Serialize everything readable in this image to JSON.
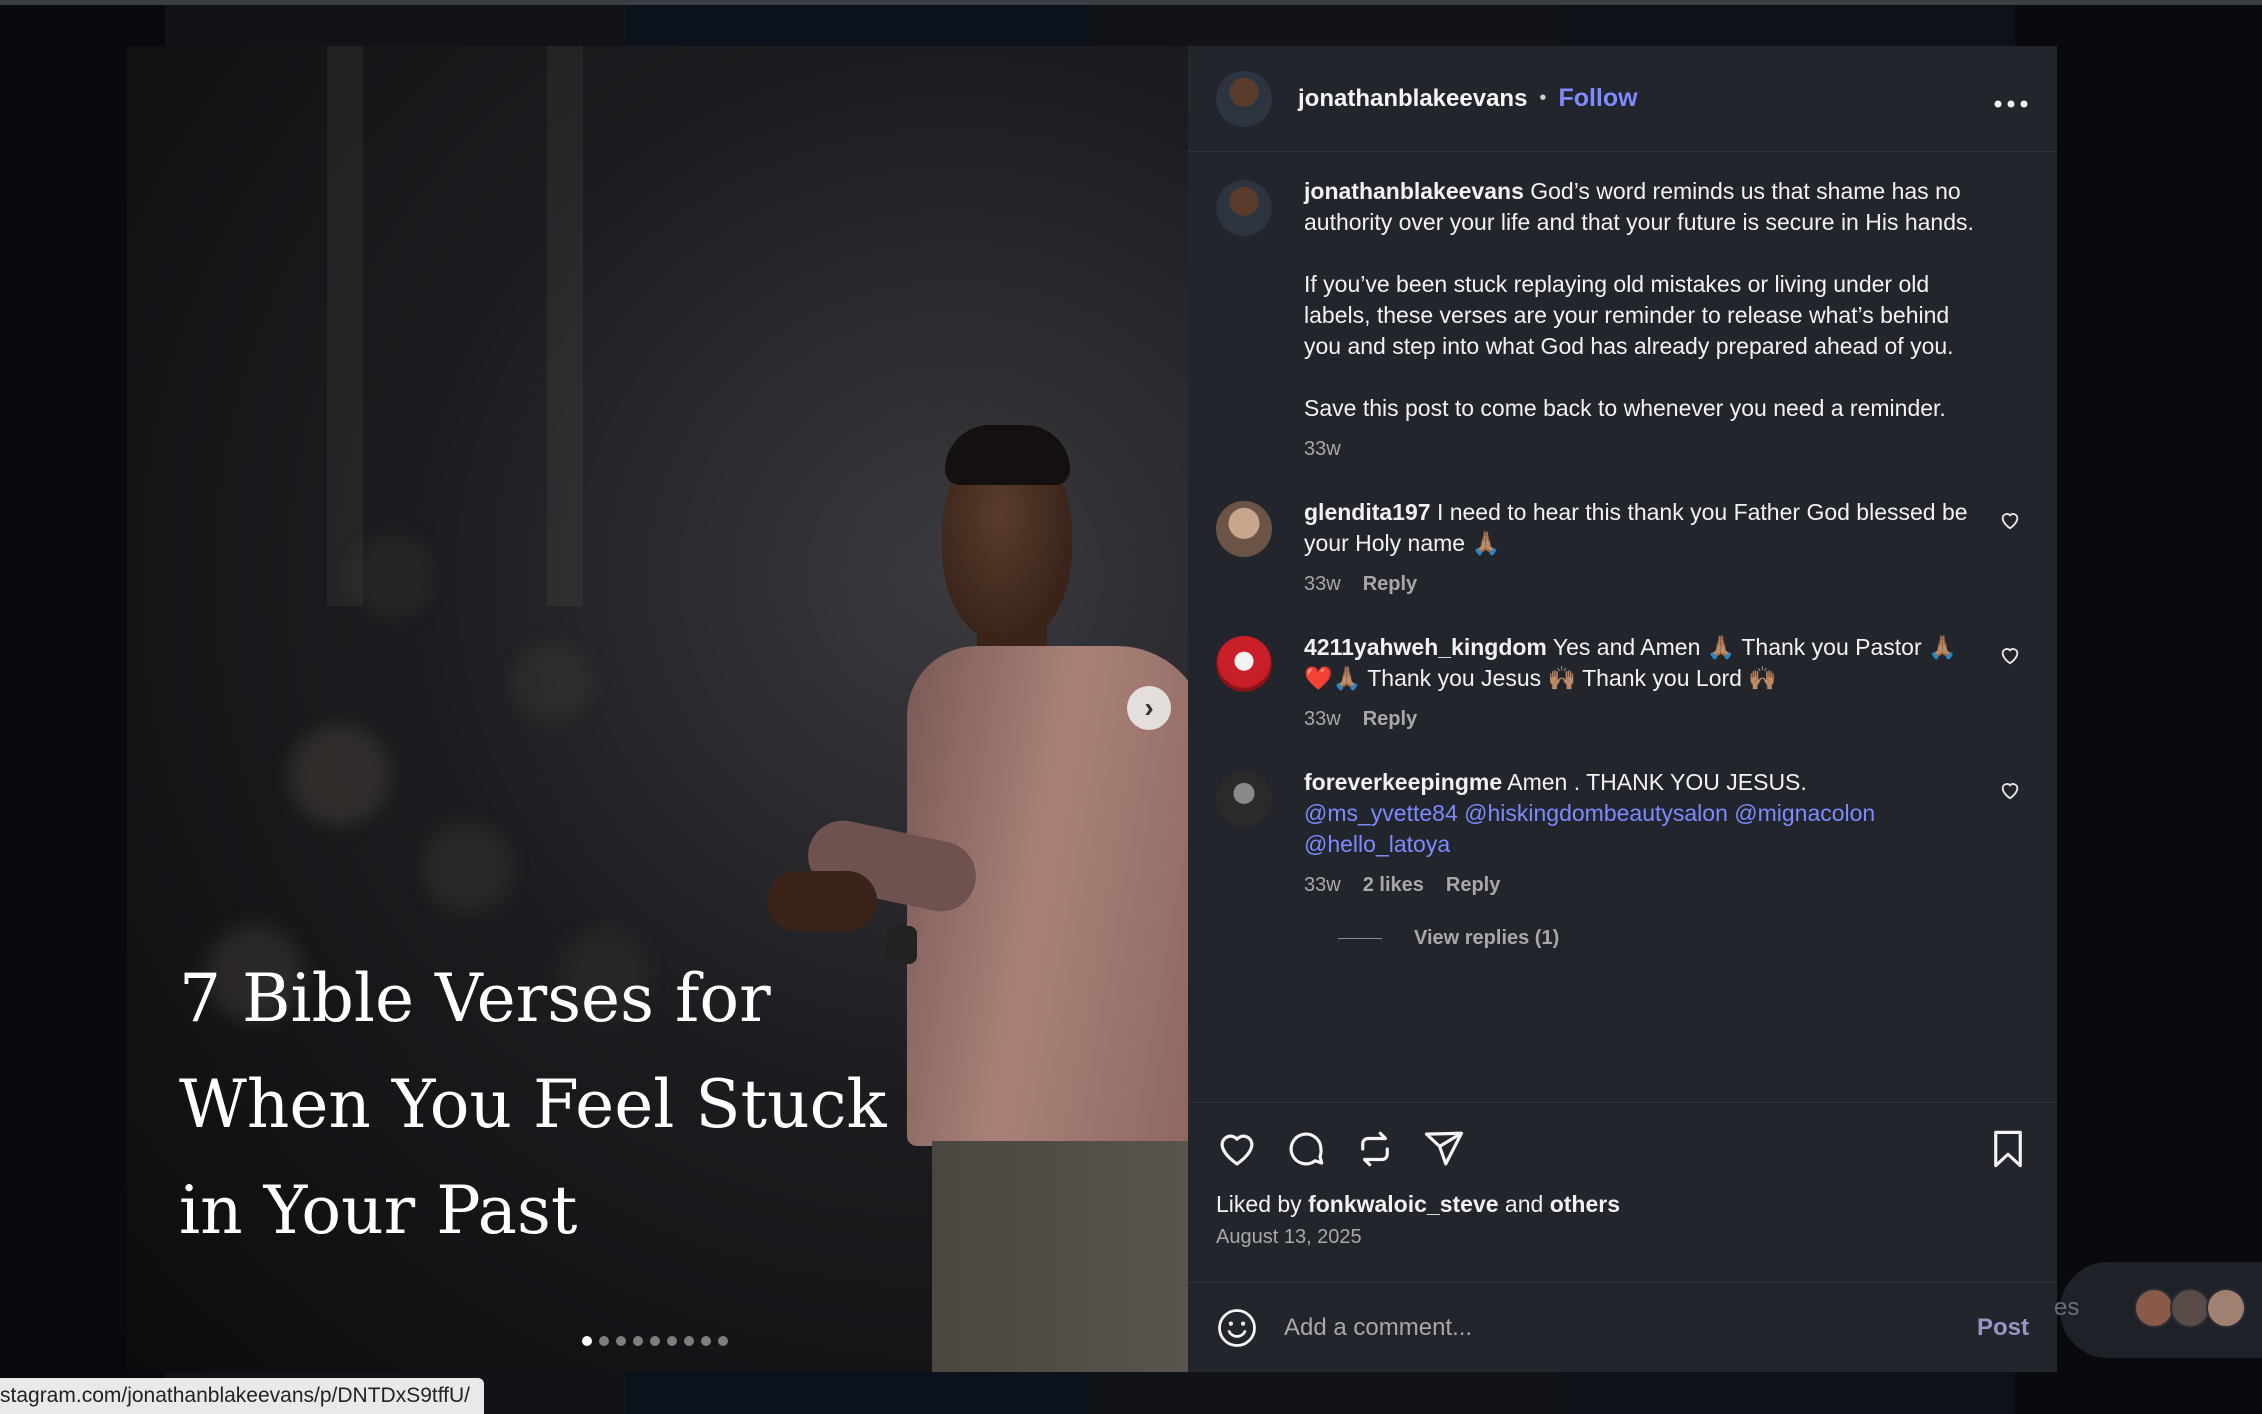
{
  "post": {
    "author": "jonathanblakeevans",
    "follow_label": "Follow",
    "separator": "•",
    "more_label": "•••",
    "media_title": "7 Bible Verses for When You Feel Stuck in Your Past",
    "next_label": "›",
    "slide_count": 9,
    "active_slide": 1
  },
  "caption": {
    "user": "jonathanblakeevans",
    "para1": "God’s word reminds us that shame has no authority over your life and that your future is secure in His hands.",
    "para2": "If you’ve been stuck replaying old mistakes or living under old labels, these verses are your reminder to release what’s behind you and step into what God has already prepared ahead of you.",
    "para3": "Save this post to come back to whenever you need a reminder.",
    "time": "33w"
  },
  "comments": [
    {
      "user": "glendita197",
      "text": "I need to hear this thank you Father God blessed be your Holy name 🙏🏽",
      "time": "33w",
      "reply": "Reply"
    },
    {
      "user": "4211yahweh_kingdom",
      "text": "Yes and Amen 🙏🏽 Thank you Pastor 🙏🏽❤️🙏🏽 Thank you Jesus 🙌🏽 Thank you Lord 🙌🏽",
      "time": "33w",
      "reply": "Reply"
    },
    {
      "user": "foreverkeepingme",
      "text": "Amen . THANK YOU JESUS.",
      "mentions": "@ms_yvette84 @hiskingdombeautysalon @mignacolon @hello_latoya",
      "time": "33w",
      "likes": "2 likes",
      "reply": "Reply",
      "view_replies": "View replies (1)"
    }
  ],
  "actions": {
    "liked_prefix": "Liked by",
    "liked_user": "fonkwaloic_steve",
    "liked_and": "and",
    "liked_others": "others",
    "date": "August 13, 2025"
  },
  "composer": {
    "placeholder": "Add a comment...",
    "post_label": "Post"
  },
  "status_bar": {
    "url": "stagram.com/jonathanblakeevans/p/DNTDxS9tffU/"
  },
  "side_chip": {
    "text": "es"
  },
  "colors": {
    "panel_bg": "#22252b",
    "link": "#7d8bff",
    "muted": "#a8a8a8"
  }
}
